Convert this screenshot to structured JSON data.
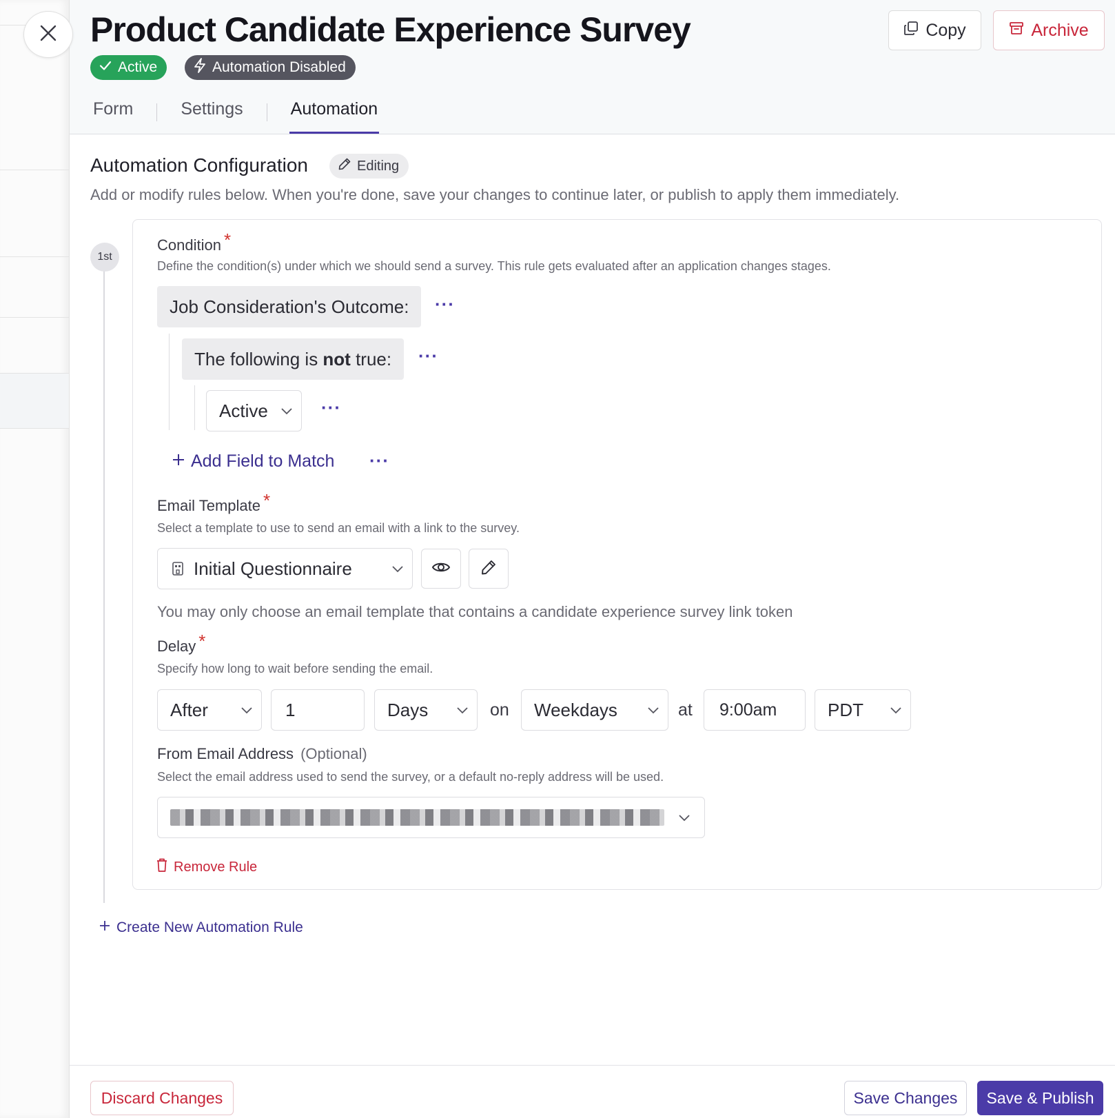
{
  "survey": {
    "title": "Product Candidate Experience Survey",
    "status_badge": "Active",
    "automation_badge": "Automation Disabled"
  },
  "actions": {
    "copy_label": "Copy",
    "archive_label": "Archive"
  },
  "tabs": [
    {
      "label": "Form",
      "active": false
    },
    {
      "label": "Settings",
      "active": false
    },
    {
      "label": "Automation",
      "active": true
    }
  ],
  "automation": {
    "section_title": "Automation Configuration",
    "editing_label": "Editing",
    "description": "Add or modify rules below. When you're done, save your changes to continue later, or publish to apply them immediately."
  },
  "rule": {
    "step_label": "1st",
    "condition": {
      "label": "Condition",
      "required_mark": "*",
      "help": "Define the condition(s) under which we should send a survey. This rule gets evaluated after an application changes stages.",
      "group_label": "Job Consideration's Outcome:",
      "negation_prefix": "The following is ",
      "negation_bold": "not",
      "negation_suffix": " true:",
      "value_select": "Active",
      "add_field_label": "Add Field to Match",
      "more_glyph": "···"
    },
    "email_template": {
      "label": "Email Template",
      "required_mark": "*",
      "help": "Select a template to use to send an email with a link to the survey.",
      "selected": "Initial Questionnaire",
      "note": "You may only choose an email template that contains a candidate experience survey link token"
    },
    "delay": {
      "label": "Delay",
      "required_mark": "*",
      "help": "Specify how long to wait before sending the email.",
      "when": "After",
      "amount": "1",
      "unit": "Days",
      "on_word": "on",
      "days": "Weekdays",
      "at_word": "at",
      "time": "9:00am",
      "timezone": "PDT"
    },
    "from_email": {
      "label": "From Email Address",
      "optional": "(Optional)",
      "help": "Select the email address used to send the survey, or a default no-reply address will be used."
    },
    "remove_label": "Remove Rule"
  },
  "create_rule_label": "Create New Automation Rule",
  "footer": {
    "discard_label": "Discard Changes",
    "save_label": "Save Changes",
    "publish_label": "Save & Publish"
  },
  "colors": {
    "accent": "#4b3ba8",
    "danger": "#c8263a",
    "success": "#27a35a",
    "muted_badge": "#55555f"
  },
  "icons": [
    "close-icon",
    "check-icon",
    "lightning-icon",
    "copy-icon",
    "archive-icon",
    "pencil-icon",
    "chevron-down-icon",
    "plus-icon",
    "template-icon",
    "eye-icon",
    "trash-icon"
  ]
}
